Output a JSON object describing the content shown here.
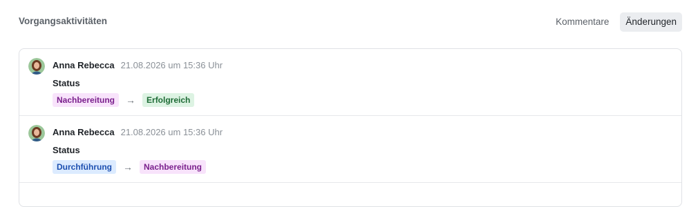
{
  "header": {
    "title": "Vorgangsaktivitäten",
    "tabs": [
      {
        "label": "Kommentare",
        "active": false
      },
      {
        "label": "Änderungen",
        "active": true
      }
    ]
  },
  "activities": [
    {
      "author": "Anna Rebecca",
      "timestamp": "21.08.2026 um 15:36 Uhr",
      "field": "Status",
      "from": {
        "label": "Nachbereitung",
        "color": "purple"
      },
      "arrow": "→",
      "to": {
        "label": "Erfolgreich",
        "color": "green"
      }
    },
    {
      "author": "Anna Rebecca",
      "timestamp": "21.08.2026 um 15:36 Uhr",
      "field": "Status",
      "from": {
        "label": "Durchführung",
        "color": "blue"
      },
      "arrow": "→",
      "to": {
        "label": "Nachbereitung",
        "color": "purple"
      }
    }
  ],
  "colors": {
    "purple_bg": "#f8e3fb",
    "purple_fg": "#7a1f8c",
    "green_bg": "#ddf3e3",
    "green_fg": "#1d6b35",
    "blue_bg": "#dcebff",
    "blue_fg": "#1c4fb0"
  }
}
